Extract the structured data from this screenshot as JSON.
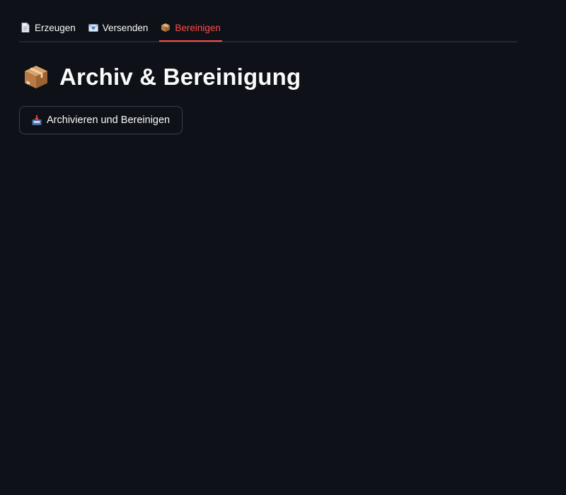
{
  "tabs": [
    {
      "label": "Erzeugen",
      "icon": "page-facing-up-icon",
      "active": false
    },
    {
      "label": "Versenden",
      "icon": "email-envelope-icon",
      "active": false
    },
    {
      "label": "Bereinigen",
      "icon": "package-box-icon",
      "active": true
    }
  ],
  "main": {
    "title": "Archiv & Bereinigung",
    "title_icon": "package-box-icon",
    "archive_button_label": "Archivieren und Bereinigen",
    "archive_button_icon": "inbox-tray-icon"
  },
  "colors": {
    "background": "#0e1117",
    "active_tab": "#ff4b4b",
    "text": "#fafafa",
    "button_border": "#3d3f47"
  }
}
